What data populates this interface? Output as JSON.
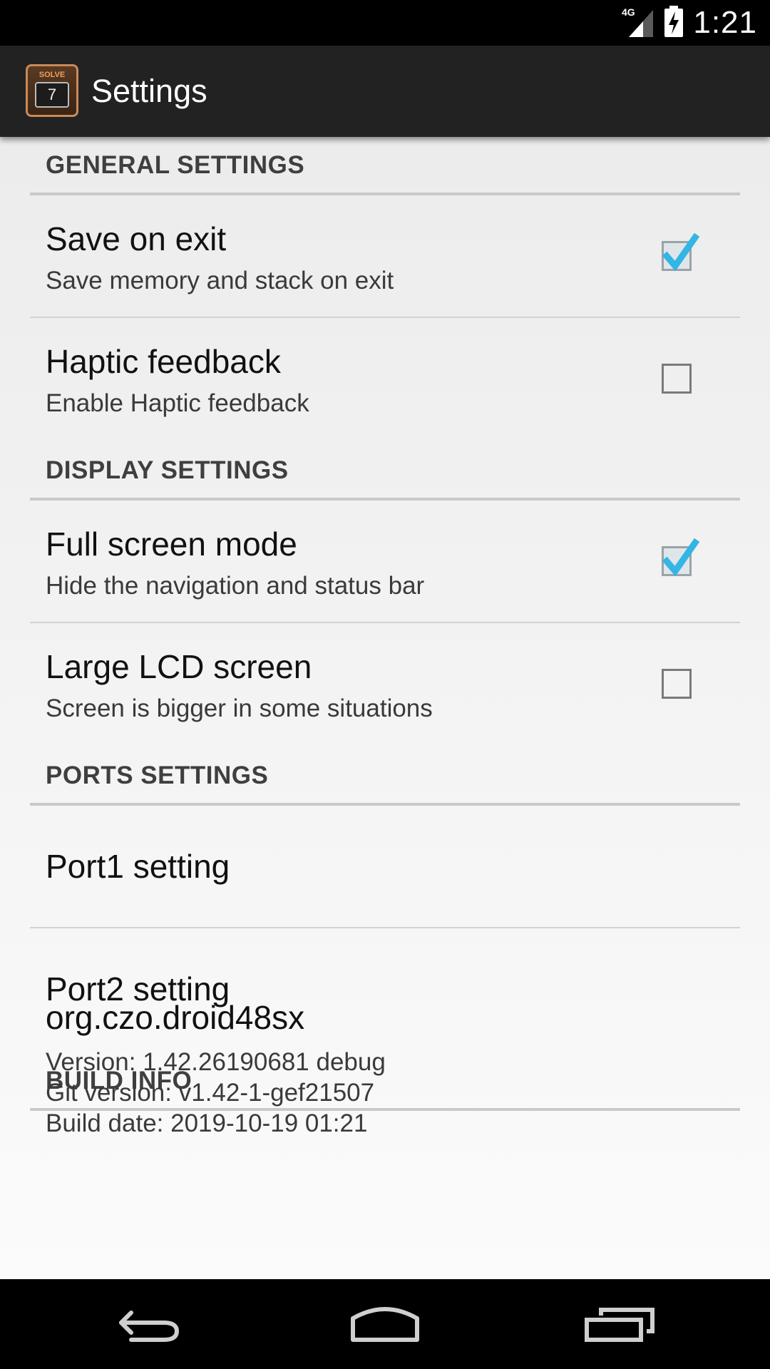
{
  "status_bar": {
    "network_type": "4G",
    "time": "1:21",
    "icons": [
      "signal-icon",
      "battery-charging-icon"
    ]
  },
  "action_bar": {
    "app_icon_label": "SOLVE",
    "app_icon_key": "7",
    "title": "Settings"
  },
  "general": {
    "header": "GENERAL SETTINGS",
    "save_on_exit": {
      "title": "Save on exit",
      "summary": "Save memory and stack on exit",
      "checked": true
    },
    "haptic": {
      "title": "Haptic feedback",
      "summary": "Enable Haptic feedback",
      "checked": false
    }
  },
  "display": {
    "header": "DISPLAY SETTINGS",
    "full_screen": {
      "title": "Full screen mode",
      "summary": "Hide the navigation and status bar",
      "checked": true
    },
    "large_lcd": {
      "title": "Large LCD screen",
      "summary": "Screen is bigger in some situations",
      "checked": false
    }
  },
  "ports": {
    "header": "PORTS SETTINGS",
    "port1": {
      "title": "Port1 setting"
    },
    "port2": {
      "title": "Port2 setting"
    }
  },
  "build": {
    "header": "BUILD INFO",
    "package": "org.czo.droid48sx",
    "version": "Version: 1.42.26190681 debug",
    "git_version": "Git version: v1.42-1-gef21507",
    "build_date": "Build date: 2019-10-19 01:21"
  },
  "nav_bar": {
    "buttons": [
      "back-icon",
      "home-icon",
      "recent-apps-icon"
    ]
  },
  "colors": {
    "checkmark": "#33b5e5",
    "action_bar": "#222222",
    "section_divider": "#c9c9c9"
  }
}
